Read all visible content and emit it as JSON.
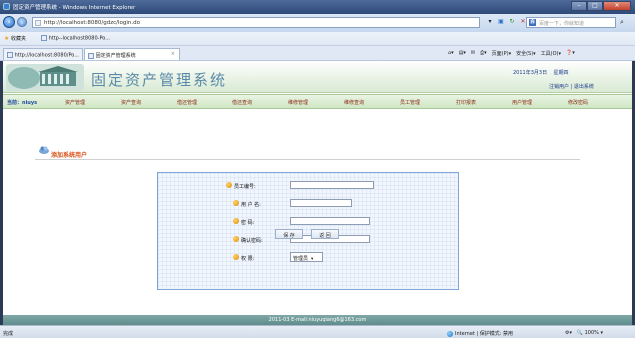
{
  "window": {
    "title": "固定资产管理系统 - Windows Internet Explorer"
  },
  "address_bar": {
    "url": "http://localhost:8080/gdzc/login.do",
    "search_placeholder": "百度一下，你就知道"
  },
  "favorites_bar": {
    "favorites_label": "收藏夹",
    "link_label": "http--localhost8080-Po..."
  },
  "tabs": [
    {
      "label": "http://localhost:8080/Po..."
    },
    {
      "label": "固定资产管理系统"
    }
  ],
  "command_bar": {
    "page_label": "页面(P)",
    "safety_label": "安全(S)",
    "tools_label": "工具(O)"
  },
  "header": {
    "system_title": "固定资产管理系统",
    "date_text": "2011年3月3日",
    "weekday_text": "星期四",
    "logout_link": "注销用户",
    "exit_link": "退出系统"
  },
  "menu": {
    "welcome_label": "当前：",
    "welcome_user": "niuys",
    "items": [
      "资产管理",
      "资产查询",
      "借还管理",
      "借还查询",
      "维修管理",
      "维修查询",
      "员工管理",
      "打印报表",
      "用户管理",
      "修改密码"
    ]
  },
  "section": {
    "title": "添加系统用户"
  },
  "form": {
    "employee_no_label": "员工编号:",
    "username_label": "用 户 名:",
    "password_label": "密    码:",
    "confirm_password_label": "确认密码:",
    "permission_label": "权    限:",
    "permission_selected": "管理员",
    "save_label": "保 存",
    "back_label": "返 回"
  },
  "footer": {
    "text": "2011-03 E-mail:niuyuqiang6@163.com"
  },
  "status_bar": {
    "status_text": "完成",
    "zone_text": "Internet | 保护模式: 禁用",
    "zoom_text": "100%"
  }
}
